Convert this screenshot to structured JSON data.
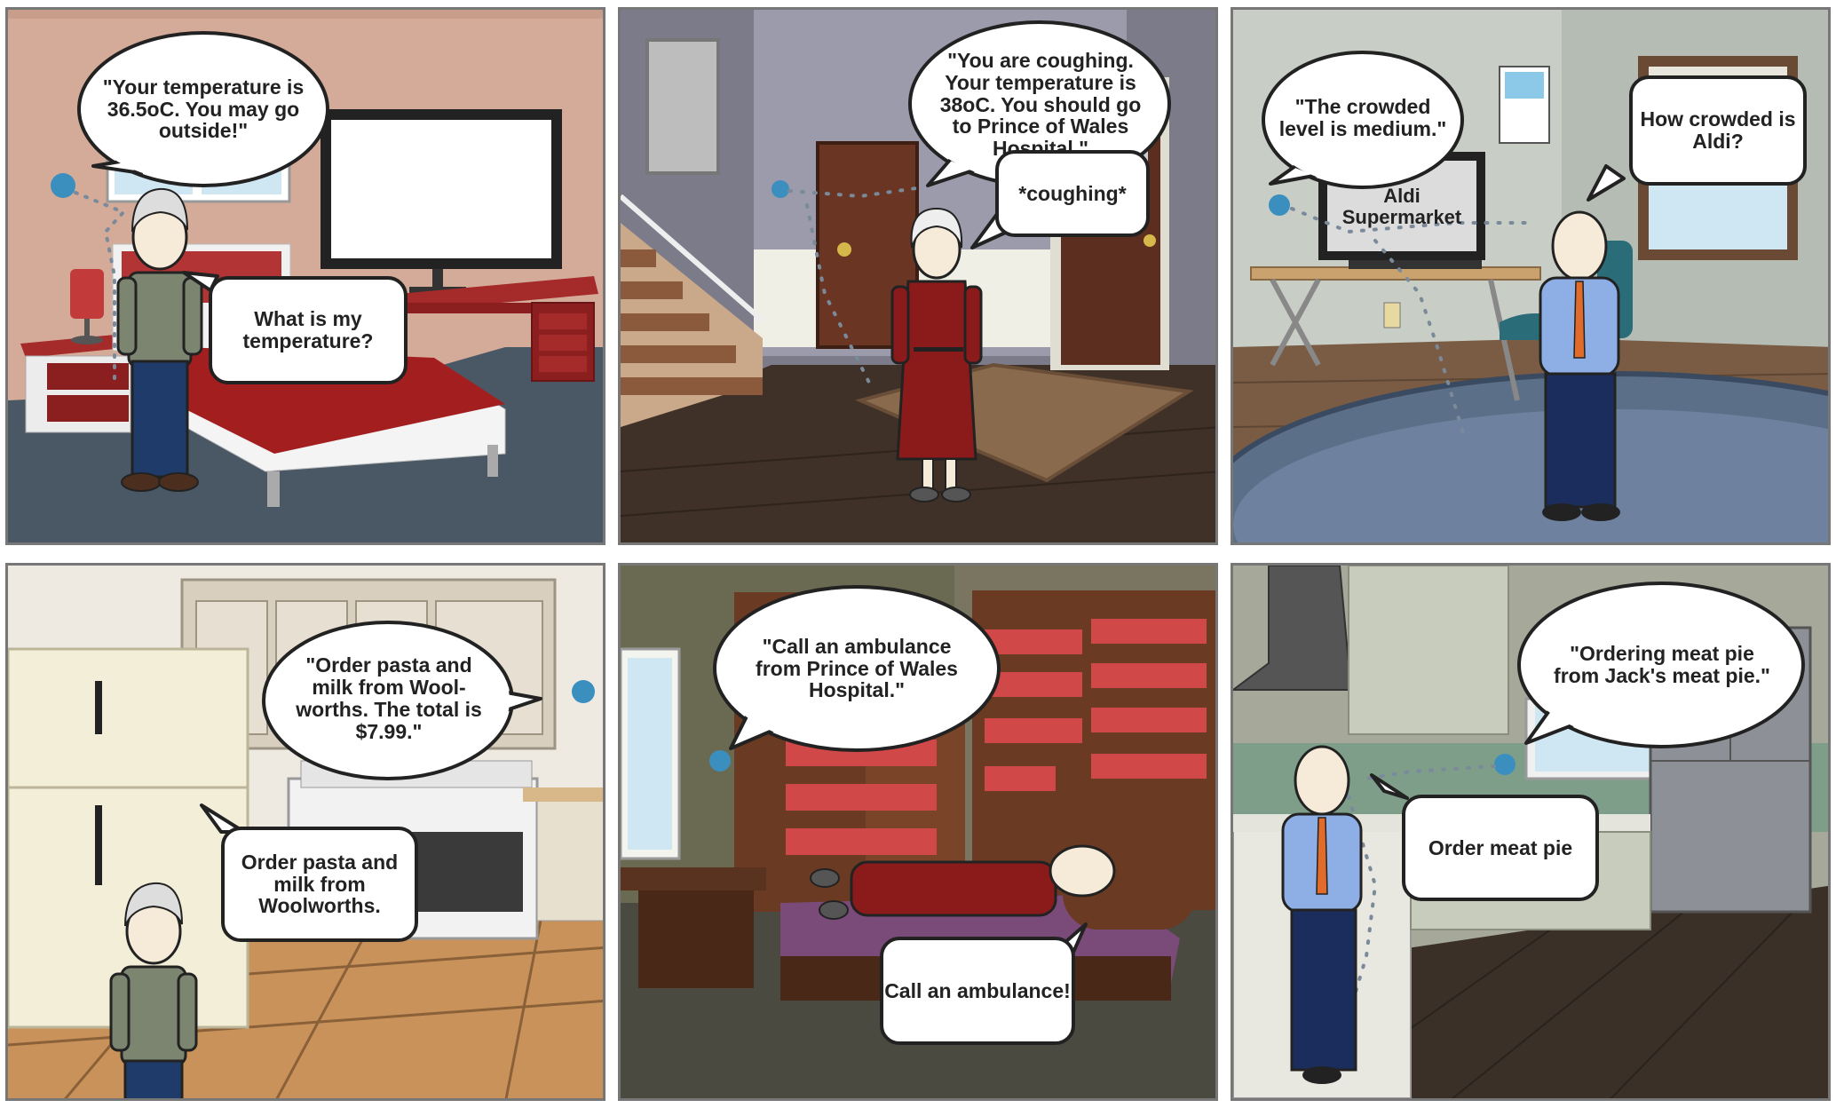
{
  "panels": [
    {
      "device": "\"Your temperature is 36.5oC. You may go outside!\"",
      "person": "What is my temperature?"
    },
    {
      "device": "\"You are coughing. Your temperature is 38oC. You should go to Prince of Wales Hospital.\"",
      "person": "*coughing*"
    },
    {
      "device": "\"The crowded level is medium.\"",
      "person": "How crowded is Aldi?",
      "screen": "Aldi Supermarket"
    },
    {
      "device": "\"Order pasta and milk from Wool-worths. The total is $7.99.\"",
      "person": "Order pasta and milk from Woolworths."
    },
    {
      "device": "\"Call an ambulance from Prince of Wales Hospital.\"",
      "person": "Call an ambulance!"
    },
    {
      "device": "\"Ordering meat pie from Jack's meat pie.\"",
      "person": "Order meat pie"
    }
  ],
  "colors": {
    "device_blue": "#3b8fbf",
    "bed_red": "#9b1c1c",
    "wood_floor": "#4a3a2a"
  }
}
